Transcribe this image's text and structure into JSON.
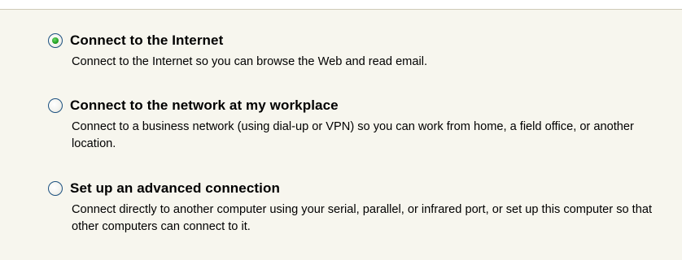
{
  "options": [
    {
      "title": "Connect to the Internet",
      "description": "Connect to the Internet so you can browse the Web and read email.",
      "selected": true
    },
    {
      "title": "Connect to the network at my workplace",
      "description": "Connect to a business network (using dial-up or VPN) so you can work from home, a field office, or another location.",
      "selected": false
    },
    {
      "title": "Set up an advanced connection",
      "description": "Connect directly to another computer using your serial, parallel, or infrared port, or set up this computer so that other computers can connect to it.",
      "selected": false
    }
  ],
  "colors": {
    "panel_background": "#f7f6ee",
    "radio_border": "#1c5180",
    "radio_selected_dot": "#22a022"
  }
}
